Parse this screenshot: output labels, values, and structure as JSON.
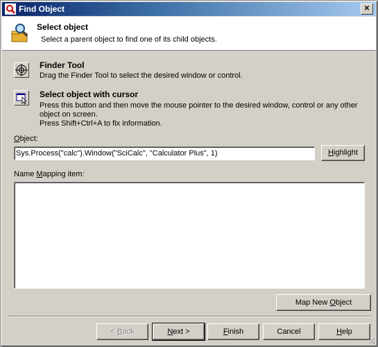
{
  "window": {
    "title": "Find Object",
    "close_glyph": "✕"
  },
  "header": {
    "title": "Select object",
    "subtitle": "Select a parent object to find one of its child objects.",
    "icon": "magnifier-folder-icon"
  },
  "options": {
    "finder": {
      "title": "Finder Tool",
      "desc": "Drag the Finder Tool to select the desired window or control.",
      "icon": "crosshair-target-icon"
    },
    "cursor": {
      "title": "Select object with cursor",
      "desc1": "Press this button and then move the mouse pointer to the desired window, control or any other",
      "desc2": "object on screen.",
      "desc3": "Press Shift+Ctrl+A to fix information.",
      "icon": "cursor-select-icon"
    }
  },
  "object": {
    "label_pre": "",
    "label_u": "O",
    "label_post": "bject:",
    "value": "Sys.Process(\"calc\").Window(\"SciCalc\", \"Calculator Plus\", 1)",
    "highlight_pre": "",
    "highlight_u": "H",
    "highlight_post": "ighlight"
  },
  "mapping": {
    "label_pre": "Name ",
    "label_u": "M",
    "label_post": "apping item:",
    "value": "",
    "map_button_pre": "Map New ",
    "map_button_u": "O",
    "map_button_post": "bject"
  },
  "footer": {
    "back_pre": "< ",
    "back_u": "B",
    "back_post": "ack",
    "next_pre": "",
    "next_u": "N",
    "next_post": "ext >",
    "finish_pre": "",
    "finish_u": "F",
    "finish_post": "inish",
    "cancel": "Cancel",
    "help_pre": "",
    "help_u": "H",
    "help_post": "elp"
  }
}
